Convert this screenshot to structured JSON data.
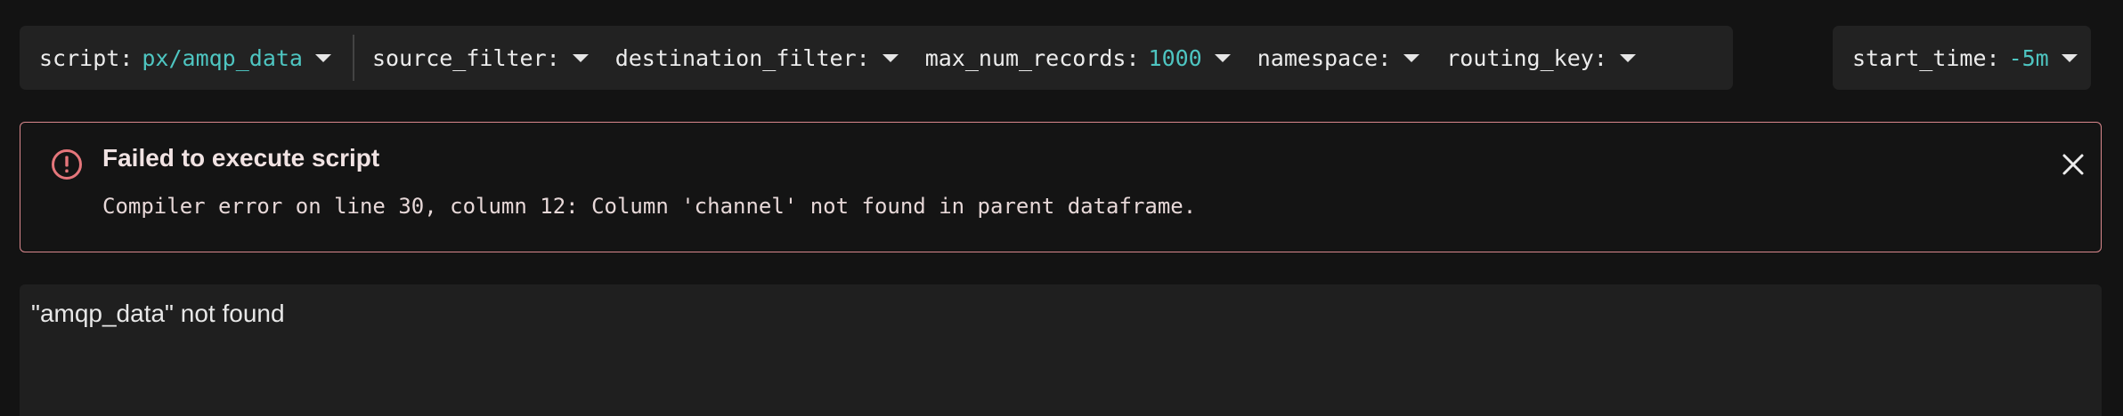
{
  "toolbar": {
    "params": [
      {
        "name": "script:",
        "value": "px/amqp_data"
      },
      {
        "name": "source_filter:",
        "value": ""
      },
      {
        "name": "destination_filter:",
        "value": ""
      },
      {
        "name": "max_num_records:",
        "value": "1000"
      },
      {
        "name": "namespace:",
        "value": ""
      },
      {
        "name": "routing_key:",
        "value": ""
      }
    ],
    "time": {
      "name": "start_time:",
      "value": "-5m"
    }
  },
  "alert": {
    "icon": "error-icon",
    "title": "Failed to execute script",
    "message": "Compiler error on line 30, column 12: Column 'channel' not found in parent dataframe.",
    "close_icon": "close-icon",
    "border_color": "#d9888d",
    "icon_color": "#e5767b"
  },
  "panel": {
    "text": "\"amqp_data\" not found"
  },
  "colors": {
    "accent": "#4ec5c1",
    "background": "#131313",
    "surface": "#222222"
  }
}
